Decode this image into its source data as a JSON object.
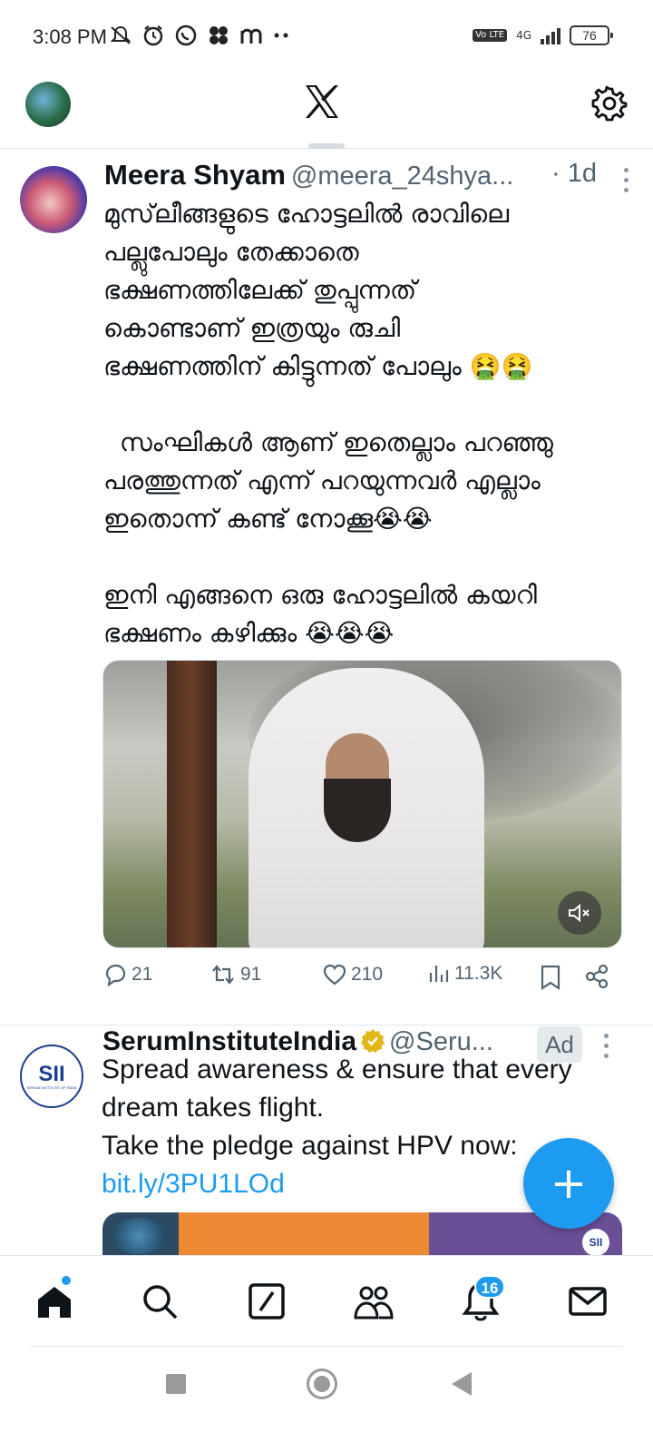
{
  "status_bar": {
    "time": "3:08 PM",
    "left_icons": [
      "muted-notifications-icon",
      "alarm-icon",
      "whatsapp-icon",
      "pinwheel-icon",
      "m-icon",
      "more-dots-icon"
    ],
    "network": "4G",
    "volte": "Vo LTE",
    "battery": "76"
  },
  "top_bar": {
    "logo": "x-logo",
    "settings": "gear-icon"
  },
  "tweets": [
    {
      "name": "Meera Shyam",
      "handle": "@meera_24shya...",
      "time": "· 1d",
      "body": "മുസ്‌ലീങ്ങളുടെ ഹോട്ടലിൽ രാവിലെ\nപല്ലുപോലും തേക്കാതെ\nഭക്ഷണത്തിലേക്ക് തുപ്പുന്നത്\nകൊണ്ടാണ് ഇത്രയും രുചി\nഭക്ഷണത്തിന് കിട്ടുന്നത് പോലും 🤮🤮\n\n  സംഘികൾ ആണ് ഇതെല്ലാം പറഞ്ഞു\nപരത്തുന്നത് എന്ന് പറയുന്നവർ എല്ലാം\nഇതൊന്ന് കണ്ട് നോക്കൂ😭😭\n\nഇനി എങ്ങനെ ഒരു ഹോട്ടലിൽ കയറി\nഭക്ഷണം കഴിക്കും 😭😭😭",
      "replies": "21",
      "reposts": "91",
      "likes": "210",
      "views": "11.3K"
    }
  ],
  "ad": {
    "name": "SerumInstituteIndia",
    "handle": "@Seru...",
    "ad_label": "Ad",
    "avatar_text": "SII",
    "avatar_subtext": "SERUM INSTITUTE OF INDIA",
    "line1": "Spread awareness & ensure that every",
    "line2": "dream takes flight.",
    "line3": "Take the pledge against HPV now:",
    "link": "bit.ly/3PU1LOd",
    "media_logo": "SII"
  },
  "fab": {
    "label": "+"
  },
  "bottom_nav": {
    "items": [
      "home-icon",
      "search-icon",
      "grok-icon",
      "communities-icon",
      "notifications-icon",
      "messages-icon"
    ],
    "notifications_count": "16"
  },
  "colors": {
    "accent": "#1d9bf0",
    "text": "#0f1419",
    "secondary": "#536471"
  }
}
